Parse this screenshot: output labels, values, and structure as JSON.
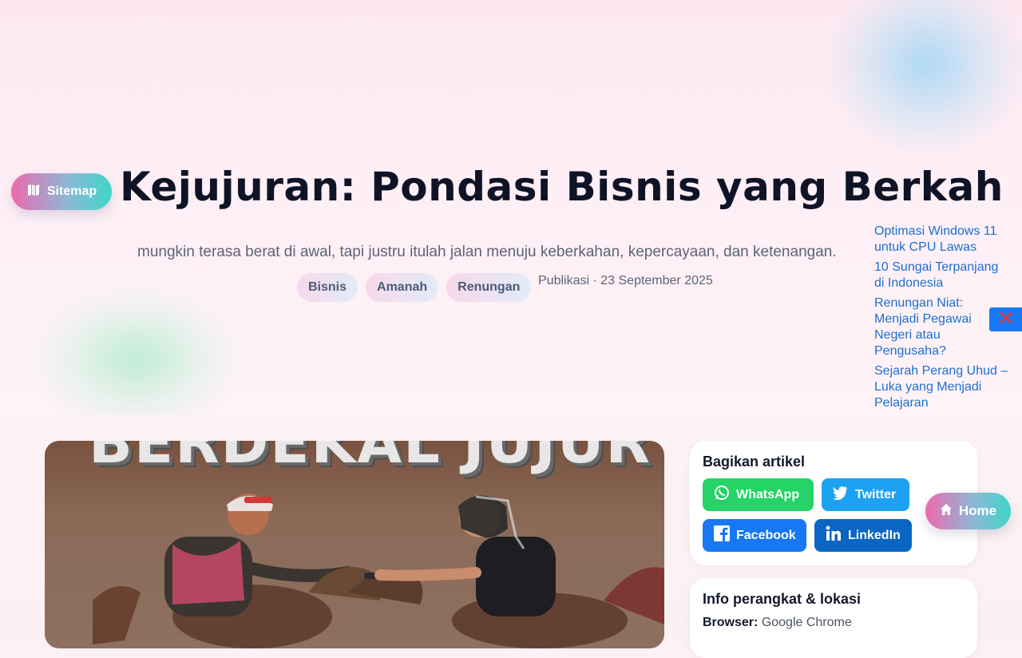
{
  "nav": {
    "sitemap_label": "Sitemap",
    "home_label": "Home"
  },
  "article": {
    "title": "Kejujuran: Pondasi Bisnis yang Berkah",
    "subtitle": "mungkin terasa berat di awal, tapi justru itulah jalan menuju keberkahan, kepercayaan, dan ketenangan.",
    "tags": [
      "Bisnis",
      "Amanah",
      "Renungan"
    ],
    "published": "Publikasi · 23 September 2025",
    "image_text": "BERDEKAL JUJUR"
  },
  "related_links": [
    "Optimasi Windows 11 untuk CPU Lawas",
    "10 Sungai Terpanjang di Indonesia",
    "Renungan Niat: Menjadi Pegawai Negeri atau Pengusaha?",
    "Sejarah Perang Uhud – Luka yang Menjadi Pelajaran"
  ],
  "share": {
    "heading": "Bagikan artikel",
    "buttons": {
      "whatsapp": "WhatsApp",
      "twitter": "Twitter",
      "facebook": "Facebook",
      "linkedin": "LinkedIn"
    }
  },
  "device_info": {
    "heading": "Info perangkat & lokasi",
    "browser_label": "Browser:",
    "browser_value": "Google Chrome"
  },
  "colors": {
    "title": "#0f1326",
    "link": "#1c6fd0",
    "whatsapp": "#25d366",
    "twitter": "#1da1f2",
    "facebook": "#1877f2",
    "linkedin": "#0a66c2",
    "close": "#1877f2",
    "close_icon": "#e53935"
  },
  "icons": {
    "sitemap": "map-icon",
    "home": "home-icon",
    "close": "close-icon",
    "whatsapp": "whatsapp-icon",
    "twitter": "twitter-icon",
    "facebook": "facebook-icon",
    "linkedin": "linkedin-icon"
  }
}
